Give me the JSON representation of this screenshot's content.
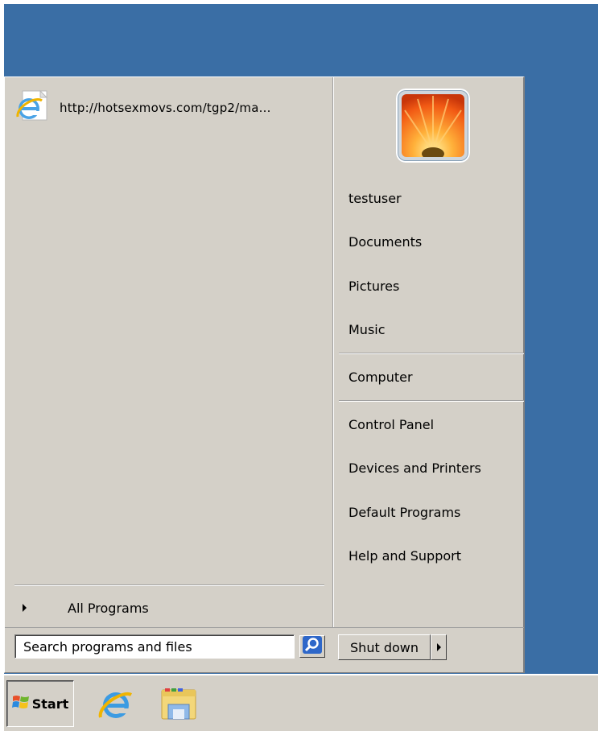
{
  "desktop": {
    "background": "#3a6ea5"
  },
  "start_menu": {
    "pinned_items": [
      {
        "label": "http://hotsexmovs.com/tgp2/ma...",
        "icon": "internet-explorer-icon"
      }
    ],
    "all_programs_label": "All Programs",
    "user": {
      "picture": "user-picture-flower"
    },
    "right_items": [
      {
        "label": "testuser"
      },
      {
        "label": "Documents"
      },
      {
        "label": "Pictures"
      },
      {
        "label": "Music"
      },
      {
        "label": "Computer"
      },
      {
        "label": "Control Panel"
      },
      {
        "label": "Devices and Printers"
      },
      {
        "label": "Default Programs"
      },
      {
        "label": "Help and Support"
      }
    ],
    "search": {
      "placeholder": "Search programs and files",
      "icon": "search-icon"
    },
    "shutdown_label": "Shut down"
  },
  "taskbar": {
    "start_label": "Start",
    "pinned": [
      {
        "icon": "internet-explorer-icon"
      },
      {
        "icon": "windows-explorer-icon"
      }
    ]
  }
}
